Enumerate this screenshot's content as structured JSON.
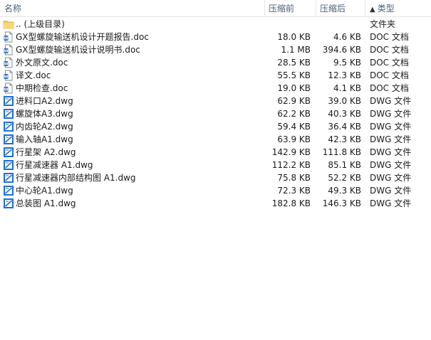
{
  "header": {
    "name": "名称",
    "compressed": "压缩前",
    "after": "压缩后",
    "type": "类型",
    "sort_arrow": "▲"
  },
  "colors": {
    "header_text": "#4c607a",
    "folder": "#f3c85a",
    "doc_icon": "#2b63b8",
    "dwg_icon": "#1f6fd1"
  },
  "rows": [
    {
      "icon": "folder-icon",
      "name": ".. (上级目录)",
      "before": "",
      "after": "",
      "type": "文件夹"
    },
    {
      "icon": "doc-icon",
      "name": "GX型螺旋输送机设计开题报告.doc",
      "before": "18.0 KB",
      "after": "4.6 KB",
      "type": "DOC 文档"
    },
    {
      "icon": "doc-icon",
      "name": "GX型螺旋输送机设计说明书.doc",
      "before": "1.1 MB",
      "after": "394.6 KB",
      "type": "DOC 文档"
    },
    {
      "icon": "doc-icon",
      "name": "外文原文.doc",
      "before": "28.5 KB",
      "after": "9.5 KB",
      "type": "DOC 文档"
    },
    {
      "icon": "doc-icon",
      "name": "译文.doc",
      "before": "55.5 KB",
      "after": "12.3 KB",
      "type": "DOC 文档"
    },
    {
      "icon": "doc-icon",
      "name": "中期检查.doc",
      "before": "19.0 KB",
      "after": "4.1 KB",
      "type": "DOC 文档"
    },
    {
      "icon": "dwg-icon",
      "name": "进料口A2.dwg",
      "before": "62.9 KB",
      "after": "39.0 KB",
      "type": "DWG 文件"
    },
    {
      "icon": "dwg-icon",
      "name": "螺旋体A3.dwg",
      "before": "62.2 KB",
      "after": "40.3 KB",
      "type": "DWG 文件"
    },
    {
      "icon": "dwg-icon",
      "name": "内齿轮A2.dwg",
      "before": "59.4 KB",
      "after": "36.4 KB",
      "type": "DWG 文件"
    },
    {
      "icon": "dwg-icon",
      "name": "输入轴A1.dwg",
      "before": "63.9 KB",
      "after": "42.3 KB",
      "type": "DWG 文件"
    },
    {
      "icon": "dwg-icon",
      "name": "行星架 A2.dwg",
      "before": "142.9 KB",
      "after": "111.8 KB",
      "type": "DWG 文件"
    },
    {
      "icon": "dwg-icon",
      "name": "行星减速器 A1.dwg",
      "before": "112.2 KB",
      "after": "85.1 KB",
      "type": "DWG 文件"
    },
    {
      "icon": "dwg-icon",
      "name": "行星减速器内部结构图 A1.dwg",
      "before": "75.8 KB",
      "after": "52.2 KB",
      "type": "DWG 文件"
    },
    {
      "icon": "dwg-icon",
      "name": "中心轮A1.dwg",
      "before": "72.3 KB",
      "after": "49.3 KB",
      "type": "DWG 文件"
    },
    {
      "icon": "dwg-icon",
      "name": "总装图 A1.dwg",
      "before": "182.8 KB",
      "after": "146.3 KB",
      "type": "DWG 文件"
    }
  ]
}
